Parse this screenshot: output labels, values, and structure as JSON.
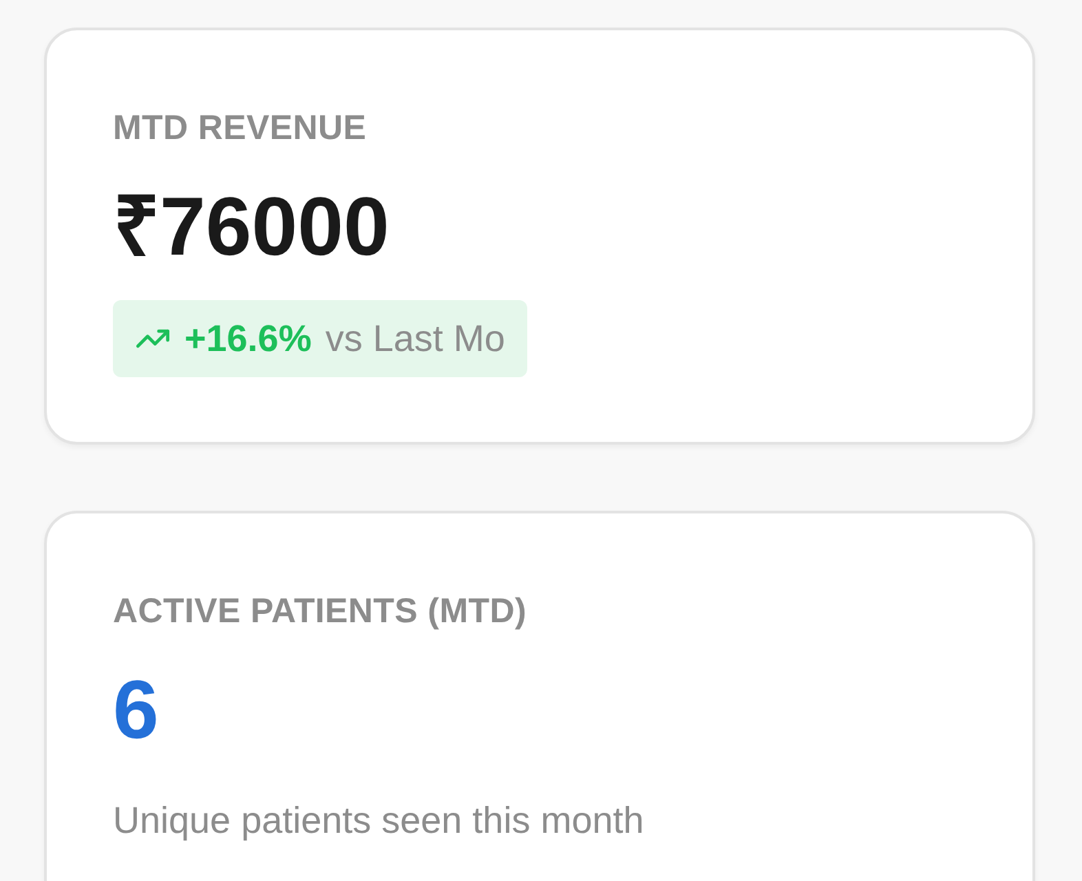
{
  "cards": [
    {
      "kind": "trend",
      "label": "MTD REVENUE",
      "value": "₹76000",
      "color": "#1a1a1a",
      "trend": {
        "positive": true,
        "change": "+16.6%",
        "comparison": "vs Last Mo"
      }
    },
    {
      "kind": "note",
      "label": "ACTIVE PATIENTS (MTD)",
      "value": "6",
      "color": "#2470d8",
      "note": "Unique patients seen this month"
    }
  ]
}
